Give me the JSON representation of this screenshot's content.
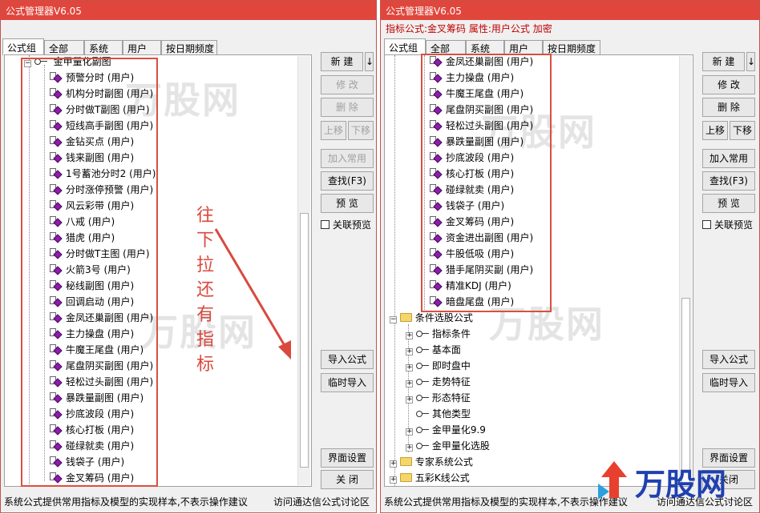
{
  "left": {
    "title": "公式管理器V6.05",
    "tabs": [
      "公式组",
      "全部",
      "系统",
      "用户",
      "按日期频度"
    ],
    "top_partial_item": "金甲量化副图",
    "items": [
      {
        "name": "预警分时",
        "tag": "(用户)"
      },
      {
        "name": "机构分时副图",
        "tag": "(用户)"
      },
      {
        "name": "分时做T副图",
        "tag": "(用户)"
      },
      {
        "name": "短线高手副图",
        "tag": "(用户)"
      },
      {
        "name": "金钻买点",
        "tag": "(用户)"
      },
      {
        "name": "钱来副图",
        "tag": "(用户)"
      },
      {
        "name": "1号蓄池分时2",
        "tag": "(用户)"
      },
      {
        "name": "分时涨停预警",
        "tag": "(用户)"
      },
      {
        "name": "风云彩带",
        "tag": "(用户)"
      },
      {
        "name": "八戒",
        "tag": "(用户)"
      },
      {
        "name": "猎虎",
        "tag": "(用户)"
      },
      {
        "name": "分时做T主图",
        "tag": "(用户)"
      },
      {
        "name": "火箭3号",
        "tag": "(用户)"
      },
      {
        "name": "秘线副图",
        "tag": "(用户)"
      },
      {
        "name": "回调启动",
        "tag": "(用户)"
      },
      {
        "name": "金凤还巢副图",
        "tag": "(用户)"
      },
      {
        "name": "主力操盘",
        "tag": "(用户)"
      },
      {
        "name": "牛魔王尾盘",
        "tag": "(用户)"
      },
      {
        "name": "尾盘阴买副图",
        "tag": "(用户)"
      },
      {
        "name": "轻松过头副图",
        "tag": "(用户)"
      },
      {
        "name": "暴跌量副图",
        "tag": "(用户)"
      },
      {
        "name": "抄底波段",
        "tag": "(用户)"
      },
      {
        "name": "核心打板",
        "tag": "(用户)"
      },
      {
        "name": "碰绿就卖",
        "tag": "(用户)"
      },
      {
        "name": "钱袋子",
        "tag": "(用户)"
      },
      {
        "name": "金叉筹码",
        "tag": "(用户)"
      }
    ],
    "buttons": {
      "new": "新 建",
      "new_arrow": "↓",
      "modify": "修 改",
      "delete": "删 除",
      "move_up": "上移",
      "move_down": "下移",
      "add_common": "加入常用",
      "find": "查找(F3)",
      "preview": "预 览",
      "link_preview": "关联预览",
      "import": "导入公式",
      "temp_import": "临时导入",
      "ui_settings": "界面设置",
      "close": "关 闭"
    },
    "annotation": [
      "往",
      "下",
      "拉",
      "还",
      "有",
      "指",
      "标"
    ],
    "status_left": "系统公式提供常用指标及模型的实现样本,不表示操作建议",
    "status_right": "访问通达信公式讨论区"
  },
  "right": {
    "title": "公式管理器V6.05",
    "info": "指标公式:金叉筹码 属性:用户公式 加密",
    "tabs": [
      "公式组",
      "全部",
      "系统",
      "用户",
      "按日期频度"
    ],
    "items": [
      {
        "name": "金凤还巢副图",
        "tag": "(用户)"
      },
      {
        "name": "主力操盘",
        "tag": "(用户)"
      },
      {
        "name": "牛魔王尾盘",
        "tag": "(用户)"
      },
      {
        "name": "尾盘阴买副图",
        "tag": "(用户)"
      },
      {
        "name": "轻松过头副图",
        "tag": "(用户)"
      },
      {
        "name": "暴跌量副图",
        "tag": "(用户)"
      },
      {
        "name": "抄底波段",
        "tag": "(用户)"
      },
      {
        "name": "核心打板",
        "tag": "(用户)"
      },
      {
        "name": "碰绿就卖",
        "tag": "(用户)"
      },
      {
        "name": "钱袋子",
        "tag": "(用户)"
      },
      {
        "name": "金叉筹码",
        "tag": "(用户)"
      },
      {
        "name": "资金进出副图",
        "tag": "(用户)"
      },
      {
        "name": "牛股低吸",
        "tag": "(用户)"
      },
      {
        "name": "猎手尾阴买副",
        "tag": "(用户)"
      },
      {
        "name": "精准KDJ",
        "tag": "(用户)"
      },
      {
        "name": "暗盘尾盘",
        "tag": "(用户)"
      }
    ],
    "groups": {
      "condition_pick": "条件选股公式",
      "sub": [
        "指标条件",
        "基本面",
        "即时盘中",
        "走势特征",
        "形态特征",
        "其他类型",
        "金甲量化9.9",
        "金甲量化选股"
      ],
      "expert": "专家系统公式",
      "kline": "五彩K线公式"
    },
    "buttons": {
      "new": "新 建",
      "new_arrow": "↓",
      "modify": "修 改",
      "delete": "删 除",
      "move_up": "上移",
      "move_down": "下移",
      "add_common": "加入常用",
      "find": "查找(F3)",
      "preview": "预 览",
      "link_preview": "关联预览",
      "import": "导入公式",
      "temp_import": "临时导入",
      "ui_settings": "界面设置",
      "close": "关闭"
    },
    "status_left": "系统公式提供常用指标及模型的实现样本,不表示操作建议",
    "status_right": "访问通达信公式讨论区"
  },
  "brand": {
    "logo_text": "万股网",
    "watermark": "万股网"
  },
  "colors": {
    "titlebar": "#e0463c",
    "annotation": "#d9493e",
    "info_text": "#c00000",
    "formula_icon": "#8a1fa8"
  }
}
